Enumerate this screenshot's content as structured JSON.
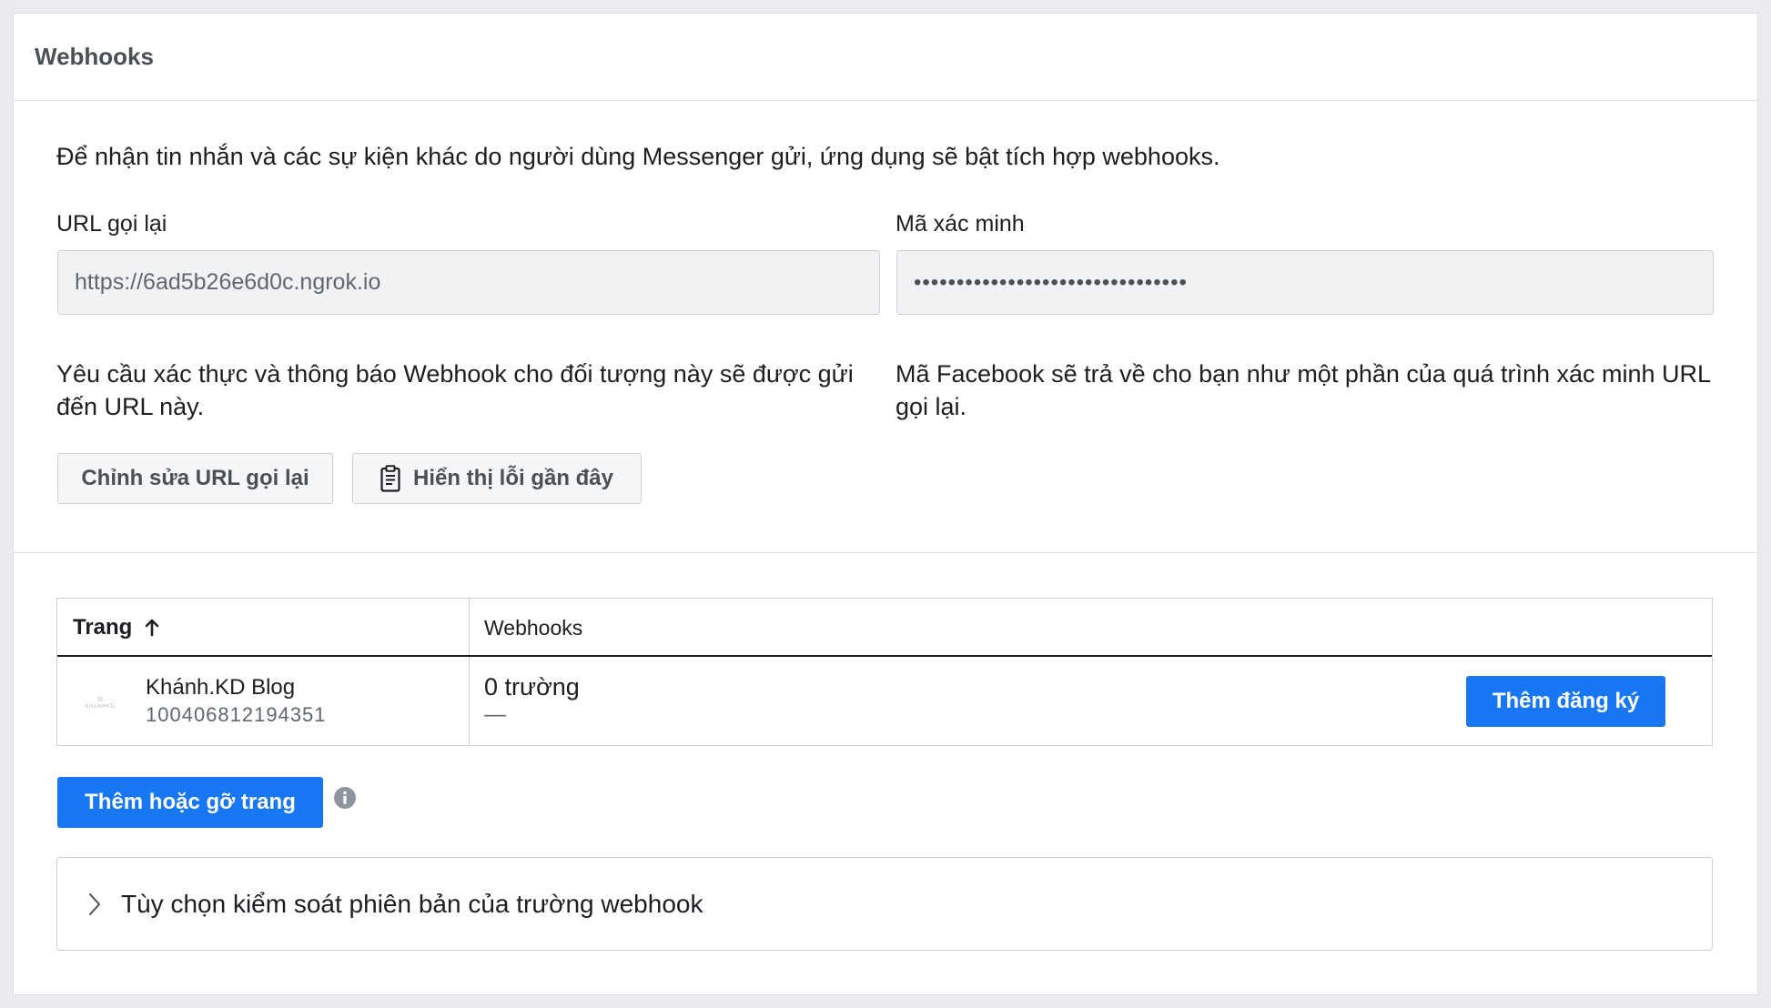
{
  "card": {
    "title": "Webhooks"
  },
  "intro": "Để nhận tin nhắn và các sự kiện khác do người dùng Messenger gửi, ứng dụng sẽ bật tích hợp webhooks.",
  "callback_url": {
    "label": "URL gọi lại",
    "value": "https://6ad5b26e6d0c.ngrok.io",
    "help": "Yêu cầu xác thực và thông báo Webhook cho đối tượng này sẽ được gửi đến URL này."
  },
  "verify_token": {
    "label": "Mã xác minh",
    "value": "••••••••••••••••••••••••••••••••",
    "help": "Mã Facebook sẽ trả về cho bạn như một phần của quá trình xác minh URL gọi lại."
  },
  "buttons": {
    "edit_callback": "Chỉnh sửa URL gọi lại",
    "show_recent_errors": "Hiển thị lỗi gần đây",
    "add_remove_pages": "Thêm hoặc gỡ trang"
  },
  "table": {
    "headers": {
      "page": "Trang",
      "webhooks": "Webhooks"
    },
    "rows": [
      {
        "avatar_text_top": "ılı",
        "avatar_text_bottom": "KHANHKD",
        "name": "Khánh.KD Blog",
        "id": "100406812194351",
        "fields": "0 trường",
        "fields_sub": "—",
        "subscribe_label": "Thêm đăng ký"
      }
    ]
  },
  "accordion": {
    "label": "Tùy chọn kiểm soát phiên bản của trường webhook"
  },
  "icons": {
    "clipboard": "clipboard-icon",
    "sort_arrow": "arrow-up-icon",
    "info": "info-icon",
    "chevron": "chevron-right-icon"
  },
  "colors": {
    "primary": "#1877f2",
    "background": "#e9ebee",
    "border": "#ccd0d5"
  }
}
